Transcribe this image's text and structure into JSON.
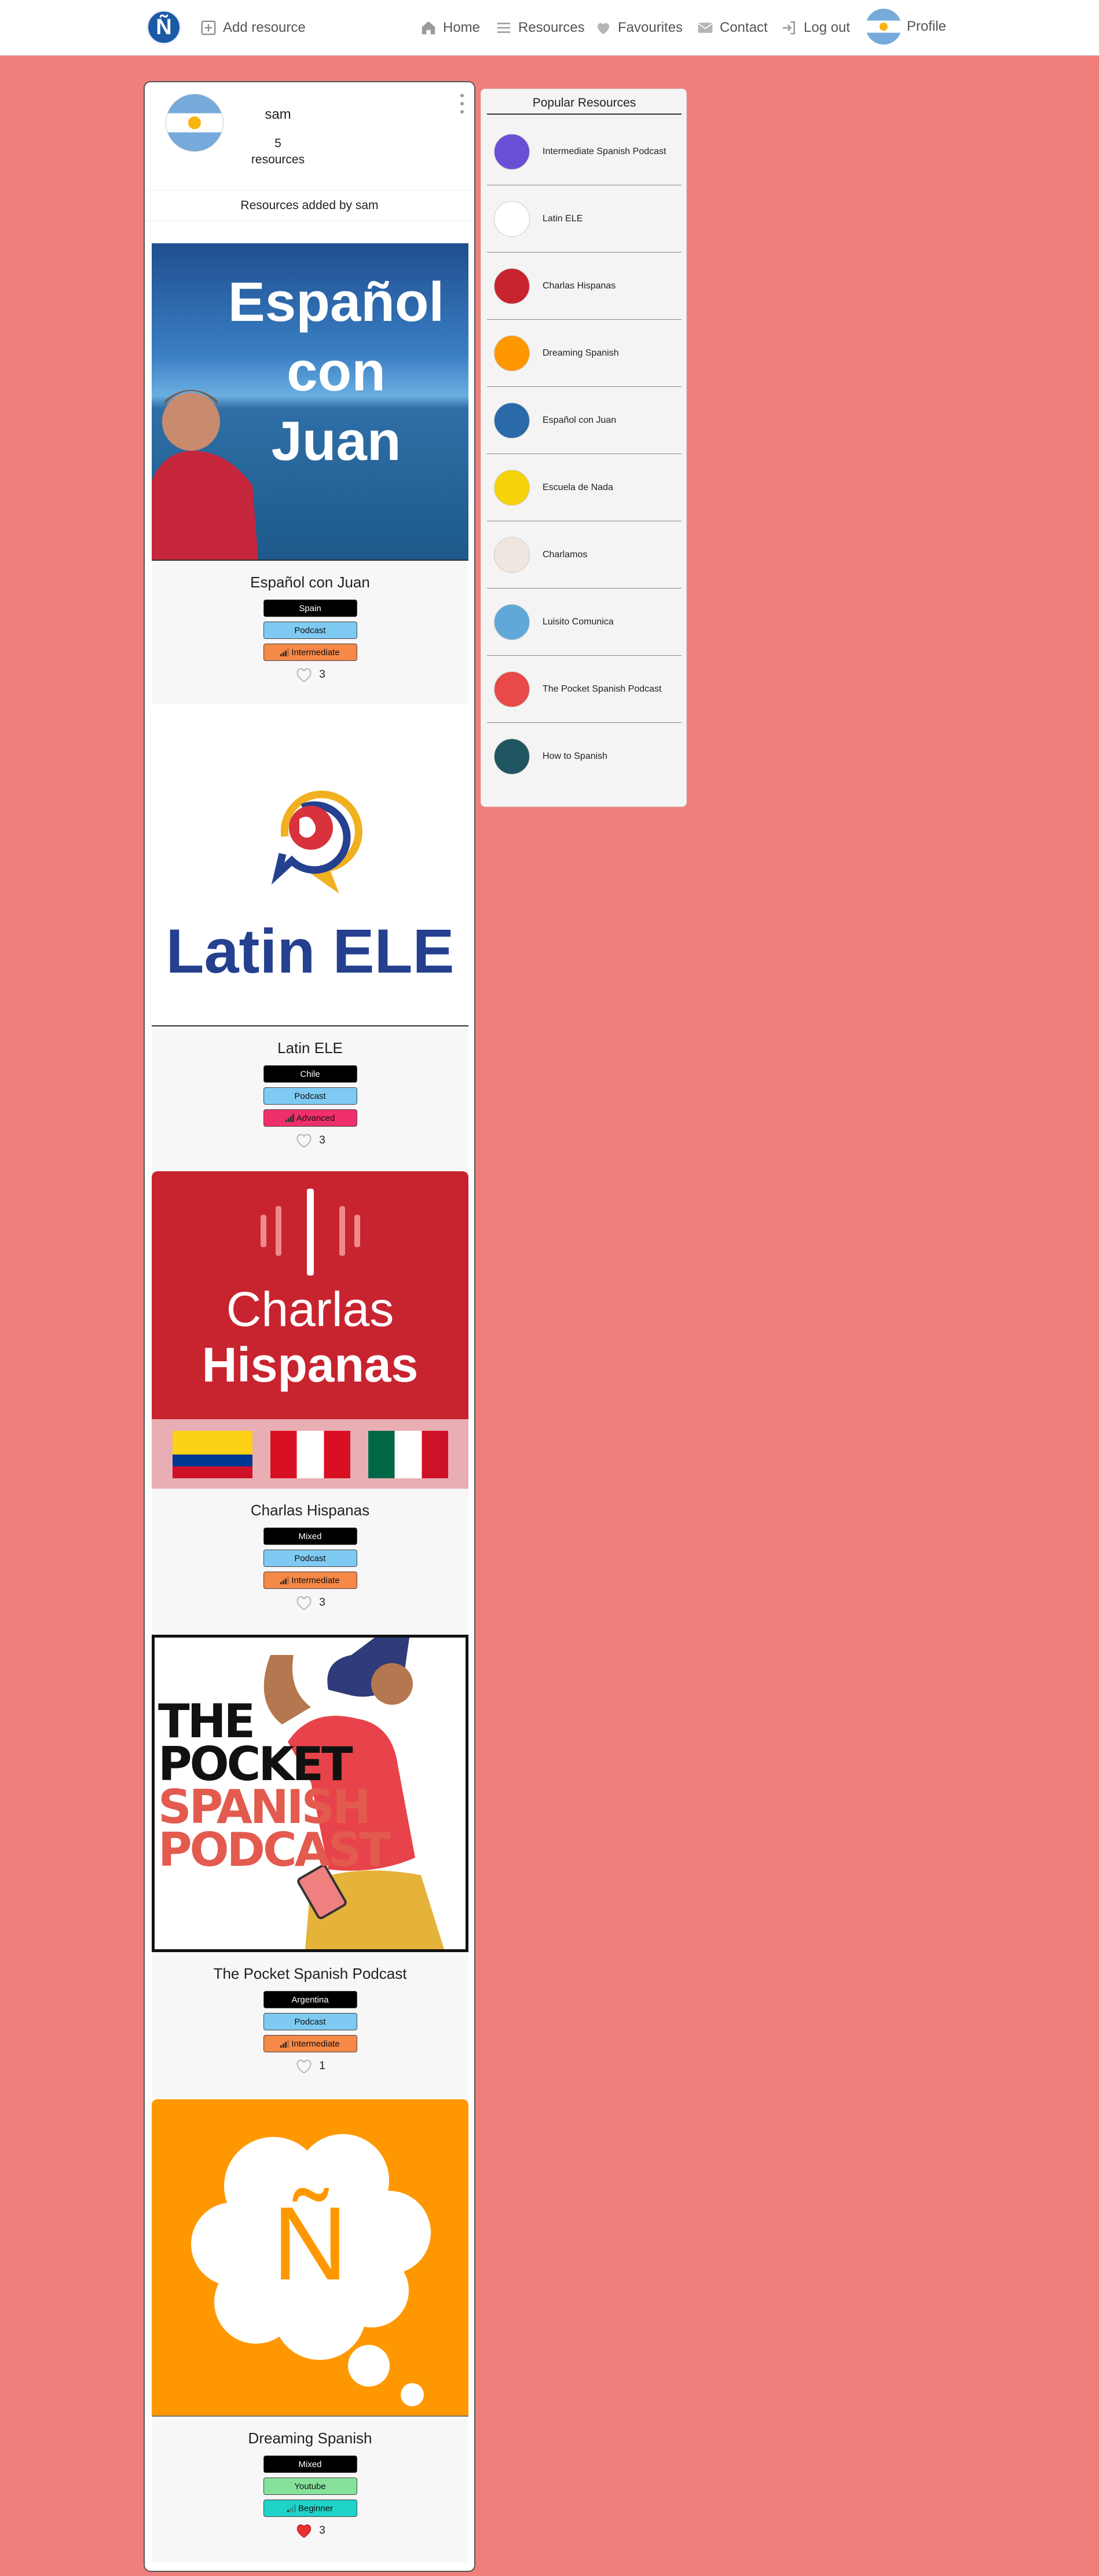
{
  "nav": {
    "logo_letter": "Ñ",
    "add_resource": "Add resource",
    "home": "Home",
    "resources": "Resources",
    "favourites": "Favourites",
    "contact": "Contact",
    "logout": "Log out",
    "profile": "Profile"
  },
  "profile": {
    "username": "sam",
    "resource_count": "5",
    "resource_count_label": "resources",
    "section_heading": "Resources added by sam"
  },
  "resources": [
    {
      "title": "Español con Juan",
      "image_text": [
        "Español",
        "con",
        "Juan"
      ],
      "country": "Spain",
      "type": "Podcast",
      "level": "Intermediate",
      "likes": "3",
      "liked": false
    },
    {
      "title": "Latin ELE",
      "image_text": [
        "Latin ELE"
      ],
      "country": "Chile",
      "type": "Podcast",
      "level": "Advanced",
      "likes": "3",
      "liked": false
    },
    {
      "title": "Charlas Hispanas",
      "image_text": [
        "Charlas",
        "Hispanas"
      ],
      "country": "Mixed",
      "type": "Podcast",
      "level": "Intermediate",
      "likes": "3",
      "liked": false
    },
    {
      "title": "The Pocket Spanish Podcast",
      "image_text": [
        "THE",
        "POCKET",
        "SPANISH",
        "PODCAST"
      ],
      "country": "Argentina",
      "type": "Podcast",
      "level": "Intermediate",
      "likes": "1",
      "liked": false
    },
    {
      "title": "Dreaming Spanish",
      "image_text": [
        "Ñ"
      ],
      "country": "Mixed",
      "type": "Youtube",
      "level": "Beginner",
      "likes": "3",
      "liked": true
    }
  ],
  "popular": {
    "title": "Popular Resources",
    "items": [
      {
        "label": "Intermediate Spanish Podcast",
        "color": "#6a4fd6"
      },
      {
        "label": "Latin ELE",
        "color": "#ffffff"
      },
      {
        "label": "Charlas Hispanas",
        "color": "#c8242f"
      },
      {
        "label": "Dreaming Spanish",
        "color": "#ff9800"
      },
      {
        "label": "Español con Juan",
        "color": "#2a6aa8"
      },
      {
        "label": "Escuela de Nada",
        "color": "#f5d20a"
      },
      {
        "label": "Charlamos",
        "color": "#efe6e0"
      },
      {
        "label": "Luisito Comunica",
        "color": "#5fa8d8"
      },
      {
        "label": "The Pocket Spanish Podcast",
        "color": "#e84a4a"
      },
      {
        "label": "How to Spanish",
        "color": "#1f5560"
      }
    ]
  },
  "colors": {
    "page_background": "#f07f7b",
    "logo_blue": "#1d5aa6",
    "podcast_tag": "#7ecaf2",
    "youtube_tag": "#86e29b",
    "intermediate_tag": "#f68848",
    "advanced_tag": "#f0306a",
    "beginner_tag": "#1fd3c8"
  }
}
